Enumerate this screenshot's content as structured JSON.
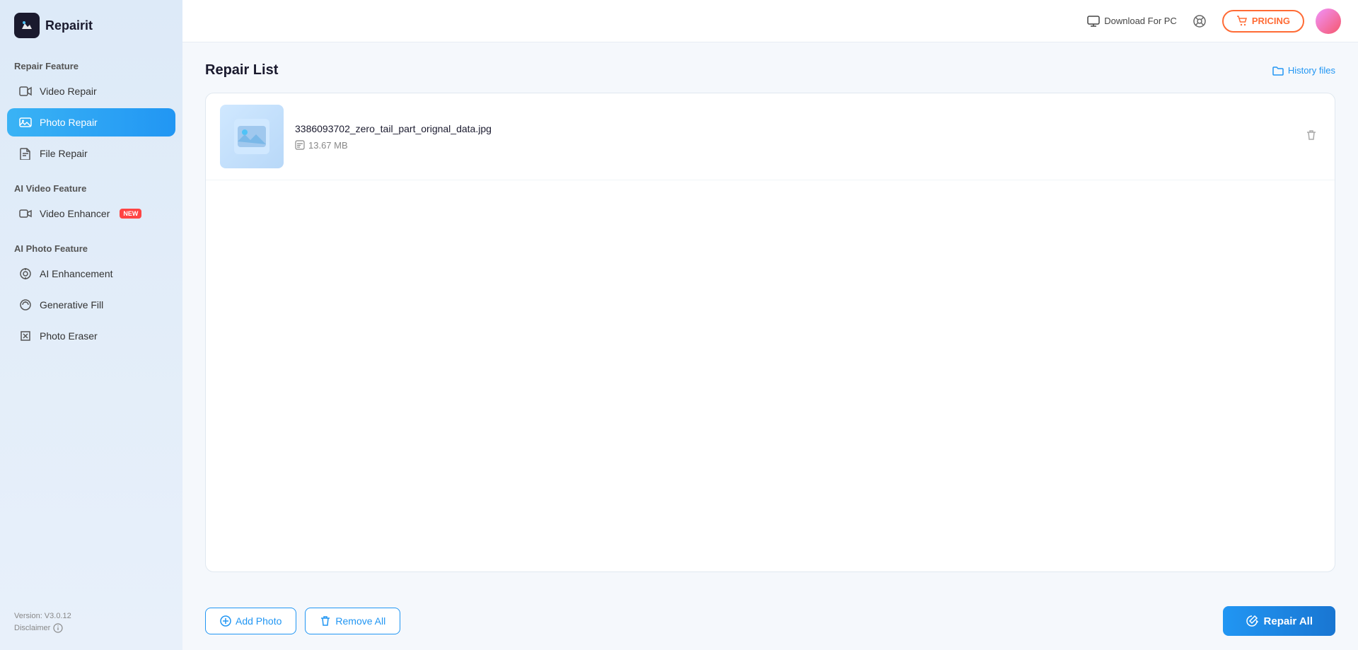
{
  "app": {
    "name": "Repairit"
  },
  "sidebar": {
    "repair_feature_label": "Repair Feature",
    "ai_video_feature_label": "AI Video Feature",
    "ai_photo_feature_label": "AI Photo Feature",
    "items": [
      {
        "id": "video-repair",
        "label": "Video Repair",
        "active": false,
        "icon": "▶"
      },
      {
        "id": "photo-repair",
        "label": "Photo Repair",
        "active": true,
        "icon": "🖼"
      },
      {
        "id": "file-repair",
        "label": "File Repair",
        "active": false,
        "icon": "📄"
      },
      {
        "id": "video-enhancer",
        "label": "Video Enhancer",
        "active": false,
        "icon": "📹",
        "badge": "NEW"
      },
      {
        "id": "ai-enhancement",
        "label": "AI Enhancement",
        "active": false,
        "icon": "✨"
      },
      {
        "id": "generative-fill",
        "label": "Generative Fill",
        "active": false,
        "icon": "🎨"
      },
      {
        "id": "photo-eraser",
        "label": "Photo Eraser",
        "active": false,
        "icon": "◇"
      }
    ],
    "version": "Version: V3.0.12",
    "disclaimer": "Disclaimer"
  },
  "header": {
    "download_label": "Download For PC",
    "pricing_label": "PRICING",
    "cart_icon": "🛒"
  },
  "main": {
    "page_title": "Repair List",
    "history_files_label": "History files",
    "repair_items": [
      {
        "id": "item-1",
        "name": "3386093702_zero_tail_part_orignal_data.jpg",
        "size": "13.67 MB"
      }
    ]
  },
  "bottom": {
    "add_photo_label": "Add Photo",
    "remove_all_label": "Remove All",
    "repair_all_label": "Repair All"
  }
}
